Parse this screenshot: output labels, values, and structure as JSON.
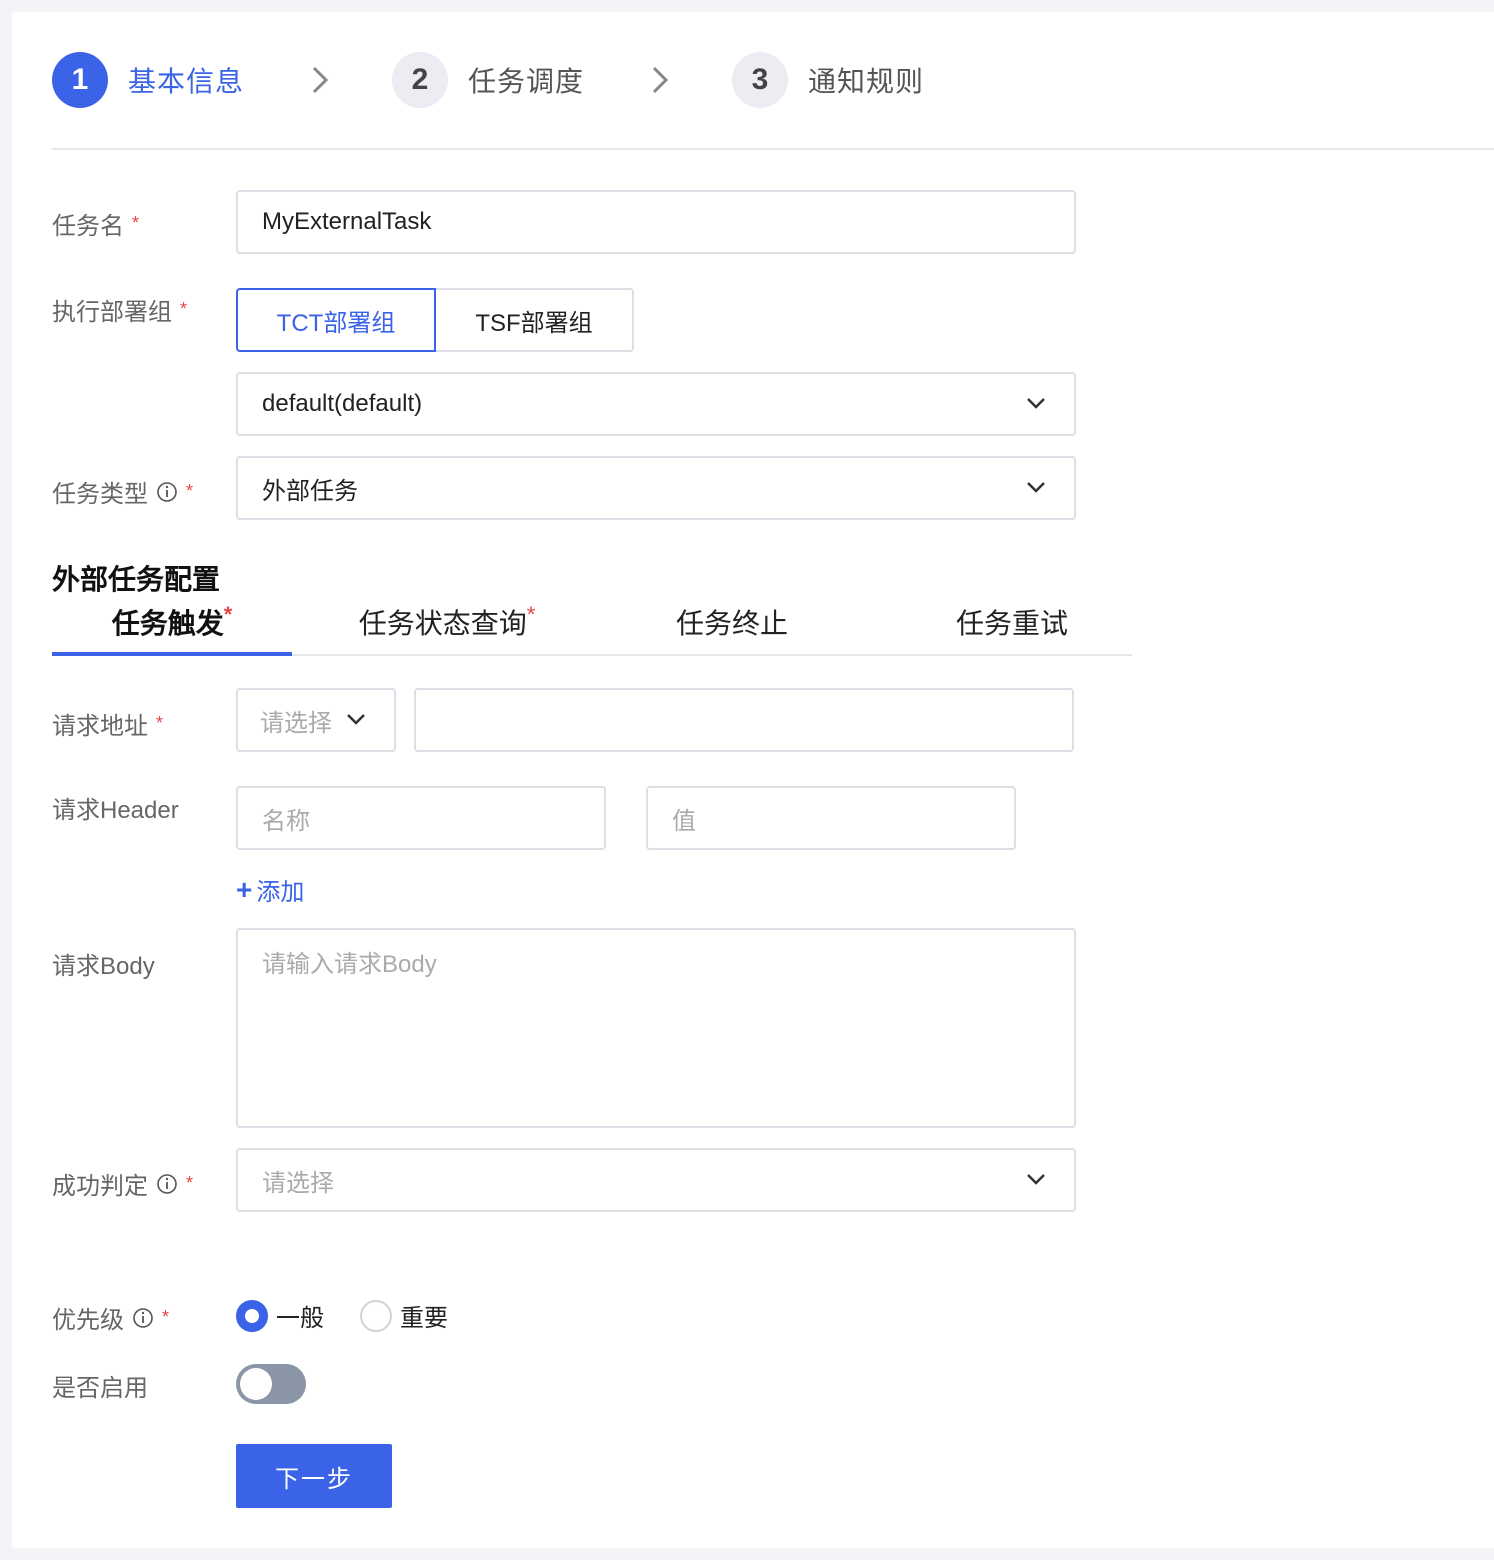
{
  "steps": [
    {
      "number": "1",
      "label": "基本信息"
    },
    {
      "number": "2",
      "label": "任务调度"
    },
    {
      "number": "3",
      "label": "通知规则"
    }
  ],
  "form": {
    "task_name": {
      "label": "任务名",
      "value": "MyExternalTask",
      "required": "*"
    },
    "deploy_group": {
      "label": "执行部署组",
      "required": "*",
      "options": [
        "TCT部署组",
        "TSF部署组"
      ],
      "selected_group": "default(default)"
    },
    "task_type": {
      "label": "任务类型",
      "value": "外部任务",
      "required": "*"
    }
  },
  "external_config": {
    "title": "外部任务配置",
    "tabs": [
      {
        "label": "任务触发",
        "star": "*"
      },
      {
        "label": "任务状态查询",
        "star": "*"
      },
      {
        "label": "任务终止",
        "star": ""
      },
      {
        "label": "任务重试",
        "star": ""
      }
    ],
    "request_url": {
      "label": "请求地址",
      "required": "*",
      "method_placeholder": "请选择",
      "url_value": ""
    },
    "request_header": {
      "label": "请求Header",
      "name_placeholder": "名称",
      "value_placeholder": "值",
      "add_label": "添加"
    },
    "request_body": {
      "label": "请求Body",
      "placeholder": "请输入请求Body"
    },
    "success_rule": {
      "label": "成功判定",
      "required": "*",
      "placeholder": "请选择"
    }
  },
  "priority": {
    "label": "优先级",
    "required": "*",
    "options": [
      "一般",
      "重要"
    ],
    "selected": "一般"
  },
  "enabled": {
    "label": "是否启用",
    "value": false
  },
  "next_button": "下一步",
  "colors": {
    "accent": "#3a63e8",
    "required": "#e54545",
    "toggle_off": "#8a95a8"
  }
}
